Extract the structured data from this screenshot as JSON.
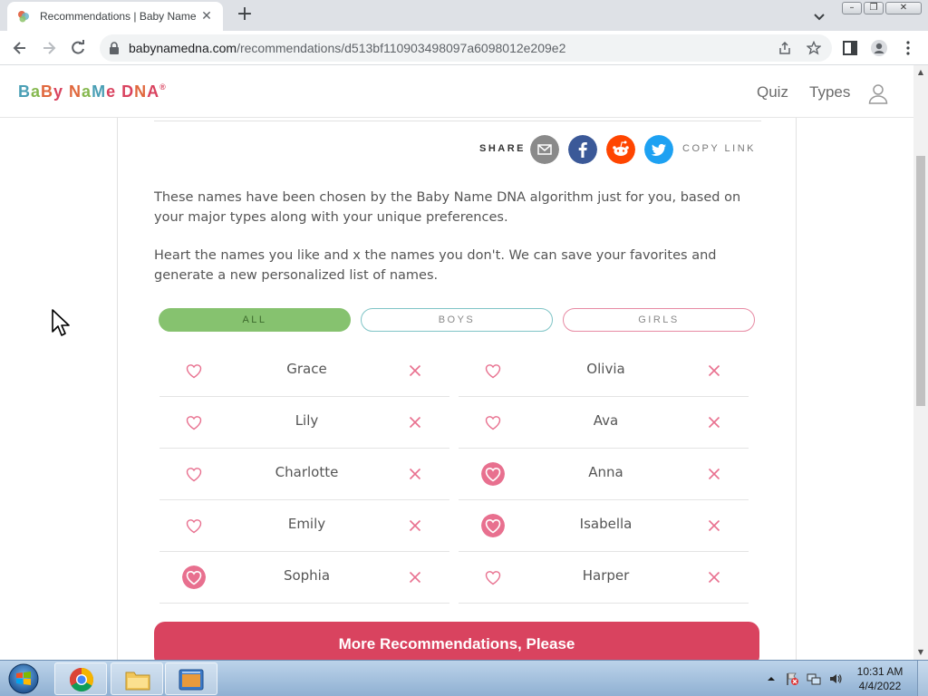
{
  "browser": {
    "tab_title": "Recommendations | Baby Name DNA",
    "url_host": "babynamedna.com",
    "url_path": "/recommendations/d513bf110903498097a6098012e209e2"
  },
  "site": {
    "logo_text": "BaBy NaMe DNA",
    "nav": {
      "quiz": "Quiz",
      "types": "Types"
    }
  },
  "share": {
    "label": "SHARE",
    "copy_link": "COPY LINK"
  },
  "intro": {
    "p1": "These names have been chosen by the Baby Name DNA algorithm just for you, based on your major types along with your unique preferences.",
    "p2": "Heart the names you like and x the names you don't. We can save your favorites and generate a new personalized list of names."
  },
  "filters": {
    "all": "ALL",
    "boys": "BOYS",
    "girls": "GIRLS",
    "selected": "ALL"
  },
  "names_left": [
    {
      "name": "Grace",
      "liked": false
    },
    {
      "name": "Lily",
      "liked": false
    },
    {
      "name": "Charlotte",
      "liked": false
    },
    {
      "name": "Emily",
      "liked": false
    },
    {
      "name": "Sophia",
      "liked": true
    }
  ],
  "names_right": [
    {
      "name": "Olivia",
      "liked": false
    },
    {
      "name": "Ava",
      "liked": false
    },
    {
      "name": "Anna",
      "liked": true
    },
    {
      "name": "Isabella",
      "liked": true
    },
    {
      "name": "Harper",
      "liked": false
    }
  ],
  "more_button": "More Recommendations, Please",
  "colors": {
    "accent_red": "#d9435f",
    "heart_pink": "#e8708f",
    "filter_green": "#86c26f",
    "filter_teal": "#7fc4c6",
    "filter_pink": "#e78aa3"
  },
  "taskbar": {
    "time": "10:31 AM",
    "date": "4/4/2022"
  }
}
